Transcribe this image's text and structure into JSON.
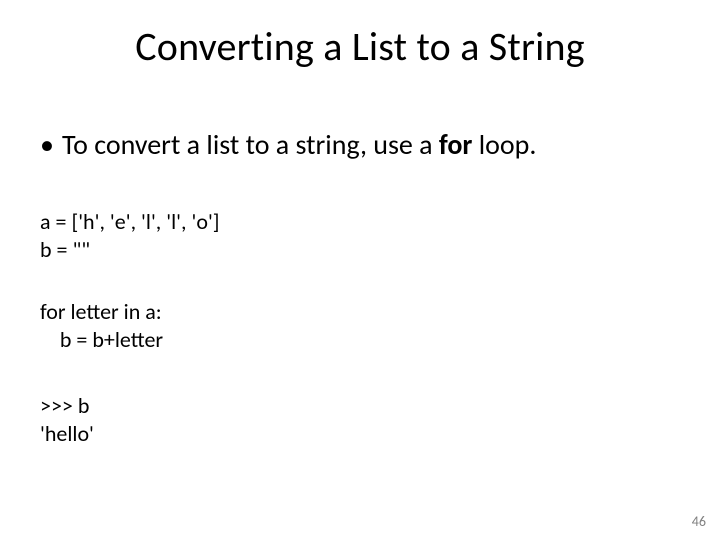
{
  "title": "Converting a List to a String",
  "intro": {
    "bullet": "•",
    "pre": "To convert a list to a string, use a ",
    "bold": "for",
    "post": " loop."
  },
  "code": {
    "assign": "a = ['h', 'e', 'l', 'l', 'o']\nb = \"\"",
    "loop": "for letter in a:\n    b = b+letter",
    "repl": ">>> b\n'hello'"
  },
  "page_number": "46"
}
